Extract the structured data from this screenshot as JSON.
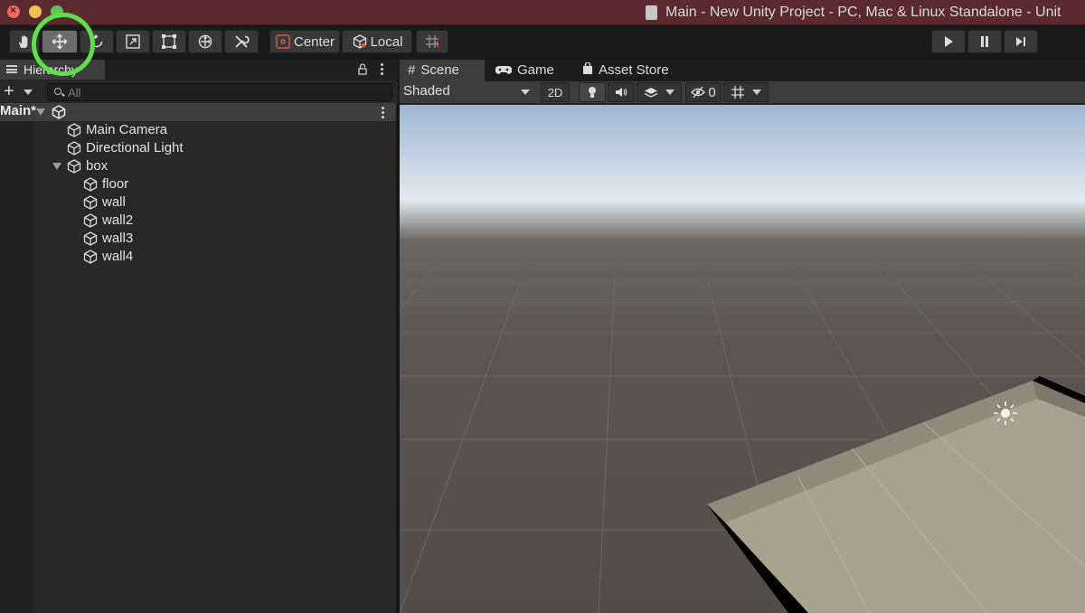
{
  "window": {
    "title": "Main - New Unity Project - PC, Mac & Linux Standalone - Unit"
  },
  "toolbar": {
    "tools": [
      {
        "name": "hand-tool",
        "icon": "hand-icon"
      },
      {
        "name": "move-tool",
        "icon": "move-arrows-icon",
        "active": true
      },
      {
        "name": "rotate-tool",
        "icon": "rotate-icon"
      },
      {
        "name": "scale-tool",
        "icon": "scale-icon"
      },
      {
        "name": "rect-tool",
        "icon": "rect-icon"
      },
      {
        "name": "transform-tool",
        "icon": "transform-icon"
      },
      {
        "name": "custom-tool",
        "icon": "wrench-icon"
      }
    ],
    "pivot_label": "Center",
    "space_label": "Local",
    "grid_snap_icon": "grid-snap-icon",
    "highlight_color": "#5ee04b"
  },
  "hierarchy": {
    "tab_label": "Hierarchy",
    "search_placeholder": "All",
    "scene_name": "Main*",
    "items": [
      {
        "label": "Main Camera"
      },
      {
        "label": "Directional Light"
      },
      {
        "label": "box"
      },
      {
        "label": "floor"
      },
      {
        "label": "wall"
      },
      {
        "label": "wall2"
      },
      {
        "label": "wall3"
      },
      {
        "label": "wall4"
      }
    ]
  },
  "scene_view": {
    "tabs": [
      {
        "label": "Scene",
        "icon": "grid-hash-icon"
      },
      {
        "label": "Game",
        "icon": "gamepad-icon"
      },
      {
        "label": "Asset Store",
        "icon": "shopping-bag-icon"
      }
    ],
    "draw_mode": "Shaded",
    "mode_2d_label": "2D",
    "hidden_count": "0",
    "sky_color": "#c6d6ea",
    "ground_color": "#57524f",
    "floor_color": "#a8a493"
  }
}
